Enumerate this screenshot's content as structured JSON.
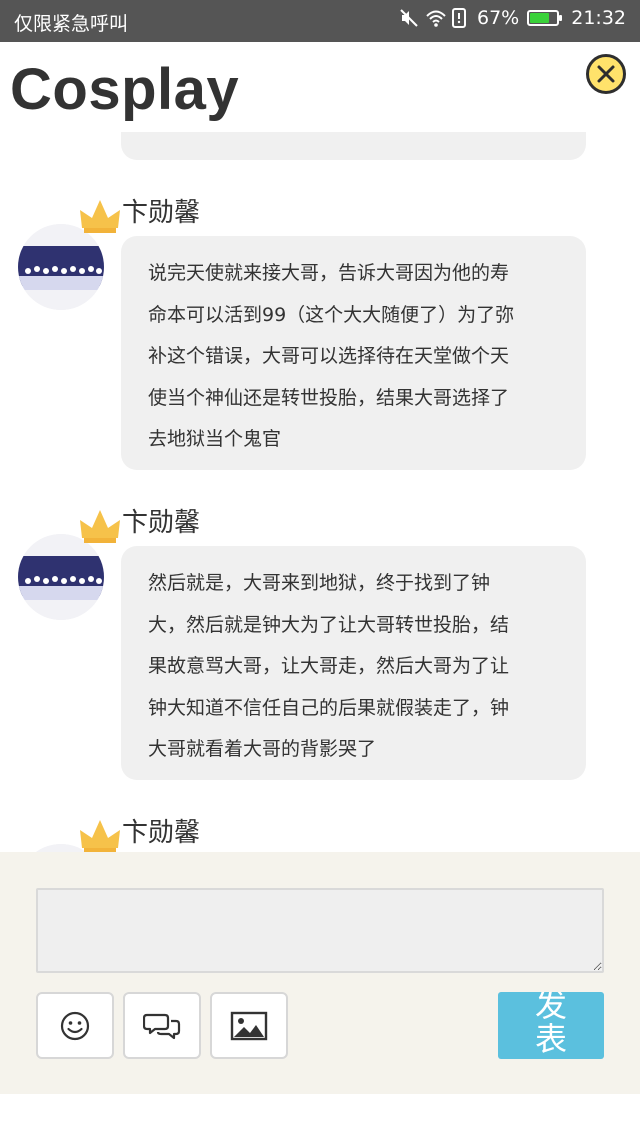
{
  "status_bar": {
    "carrier": "仅限紧急呼叫",
    "battery": "67%",
    "battery_level": 0.67,
    "time": "21:32",
    "icons": [
      "mute-icon",
      "wifi-icon",
      "sim-icon",
      "battery-icon"
    ]
  },
  "header": {
    "title": "Cosplay",
    "close_icon": "close-icon"
  },
  "colors": {
    "header_title": "#333333",
    "close_button": "#ffe26b",
    "send_button": "#5bc0de",
    "composer_bg": "#f5f3ec",
    "bubble_bg": "#f0f0f0",
    "crown": "#f6c24a"
  },
  "messages": [
    {
      "username": "卞勋馨",
      "lines": [
        "说完天使就来接大哥，告诉大哥因为他的寿",
        "命本可以活到99（这个大大随便了）为了弥",
        "补这个错误，大哥可以选择待在天堂做个天",
        "使当个神仙还是转世投胎，结果大哥选择了",
        "去地狱当个鬼官"
      ]
    },
    {
      "username": "卞勋馨",
      "lines": [
        "然后就是，大哥来到地狱，终于找到了钟",
        "大，然后就是钟大为了让大哥转世投胎，结",
        "果故意骂大哥，让大哥走，然后大哥为了让",
        "钟大知道不信任自己的后果就假装走了，钟",
        "大哥就看着大哥的背影哭了"
      ]
    },
    {
      "username": "卞勋馨"
    }
  ],
  "composer": {
    "input_value": "",
    "emoji_icon": "smiley-icon",
    "comment_icon": "chat-bubbles-icon",
    "image_icon": "image-icon",
    "send_label": "发表"
  }
}
